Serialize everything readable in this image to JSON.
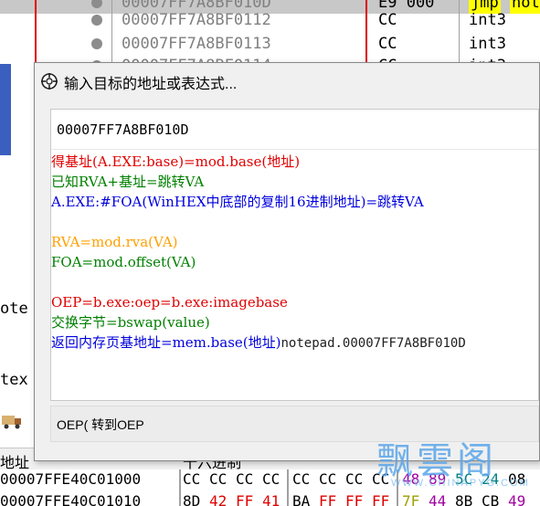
{
  "background": {
    "disasm_rows": [
      {
        "address": "00007FF7A8BF010D",
        "bytes": "E9 000",
        "instr": "jmp",
        "extra": "not",
        "selected": true
      },
      {
        "address": "00007FF7A8BF0112",
        "bytes": "CC",
        "instr": "int3",
        "selected": false
      },
      {
        "address": "00007FF7A8BF0113",
        "bytes": "CC",
        "instr": "int3",
        "selected": false
      },
      {
        "address": "00007FF7A8BF0114",
        "bytes": "CC",
        "instr": "int3",
        "selected": false
      }
    ],
    "side_text": {
      "a": "ote",
      "b": "tex"
    },
    "hex_header": {
      "address_col": "地址",
      "hex_col": "十六进制"
    },
    "hex_rows": [
      {
        "address": "00007FFE40C01000",
        "bytes": [
          "CC",
          "CC",
          "CC",
          "CC",
          "CC",
          "CC",
          "CC",
          "CC",
          "48",
          "89",
          "5C",
          "24",
          "08"
        ]
      },
      {
        "address": "00007FFE40C01010",
        "bytes": [
          "8D",
          "42",
          "FF",
          "41",
          "BA",
          "FF",
          "FF",
          "FF",
          "7F",
          "44",
          "8B",
          "CB",
          "49"
        ]
      }
    ]
  },
  "dialog": {
    "title": "输入目标的地址或表达式...",
    "input_value": "00007FF7A8BF010D",
    "help": {
      "line1": "得基址(A.EXE:base)=mod.base(地址)",
      "line2": "已知RVA+基址=跳转VA",
      "line3": "A.EXE:#FOA(WinHEX中底部的复制16进制地址)=跳转VA",
      "line4": "RVA=mod.rva(VA)",
      "line5": "FOA=mod.offset(VA)",
      "line6": "OEP=b.exe:oep=b.exe:imagebase",
      "line7": "交换字节=bswap(value)",
      "line8": "返回内存页基地址=mem.base(地址)",
      "line8_suffix": "notepad.00007FF7A8BF010D"
    },
    "footer": "OEP( 转到OEP"
  },
  "watermark": {
    "title": "飘雲阁",
    "url": "WWW.CHINAPYG.COM"
  },
  "colors": {
    "red": "#e00000",
    "green": "#008000",
    "blue": "#0000dd",
    "orange": "#ffa000",
    "watermark": "#5aa6ea"
  }
}
